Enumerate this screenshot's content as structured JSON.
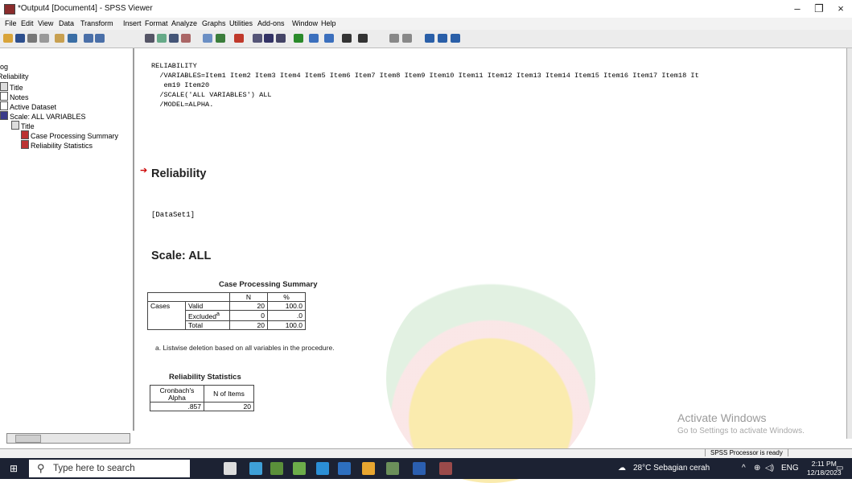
{
  "window": {
    "title": "*Output4 [Document4] - SPSS Viewer",
    "minimize": "–",
    "maximize": "❐",
    "close": "×"
  },
  "menu": [
    "File",
    "Edit",
    "View",
    "Data",
    "Transform",
    "Insert",
    "Format",
    "Analyze",
    "Graphs",
    "Utilities",
    "Add-ons",
    "Window",
    "Help"
  ],
  "outline": {
    "items": [
      "Log",
      "Reliability",
      "Title",
      "Notes",
      "Active Dataset",
      "Scale: ALL VARIABLES",
      "Title",
      "Case Processing Summary",
      "Reliability Statistics"
    ]
  },
  "syntax": "RELIABILITY\n  /VARIABLES=Item1 Item2 Item3 Item4 Item5 Item6 Item7 Item8 Item9 Item10 Item11 Item12 Item13 Item14 Item15 Item16 Item17 Item18 It\n   em19 Item20\n  /SCALE('ALL VARIABLES') ALL\n  /MODEL=ALPHA.",
  "output": {
    "heading": "Reliability",
    "dataset": "[DataSet1]",
    "scale_heading": "Scale: ALL",
    "case_summary": {
      "caption": "Case Processing Summary",
      "col_n": "N",
      "col_pct": "%",
      "group": "Cases",
      "rows": [
        {
          "label": "Valid",
          "n": "20",
          "pct": "100.0"
        },
        {
          "label": "Excluded",
          "sup": "a",
          "n": "0",
          "pct": ".0"
        },
        {
          "label": "Total",
          "n": "20",
          "pct": "100.0"
        }
      ],
      "footnote": "a. Listwise deletion based on all variables in the procedure."
    },
    "reliability": {
      "caption": "Reliability Statistics",
      "col_alpha_1": "Cronbach's",
      "col_alpha_2": "Alpha",
      "col_items": "N of Items",
      "alpha": ".857",
      "items": "20"
    }
  },
  "activation": {
    "line1": "Activate Windows",
    "line2": "Go to Settings to activate Windows."
  },
  "status": "SPSS Processor is ready",
  "taskbar": {
    "search_placeholder": "Type here to search",
    "weather": "28°C  Sebagian cerah",
    "lang": "ENG",
    "time": "2:11 PM",
    "date": "12/18/2023"
  }
}
